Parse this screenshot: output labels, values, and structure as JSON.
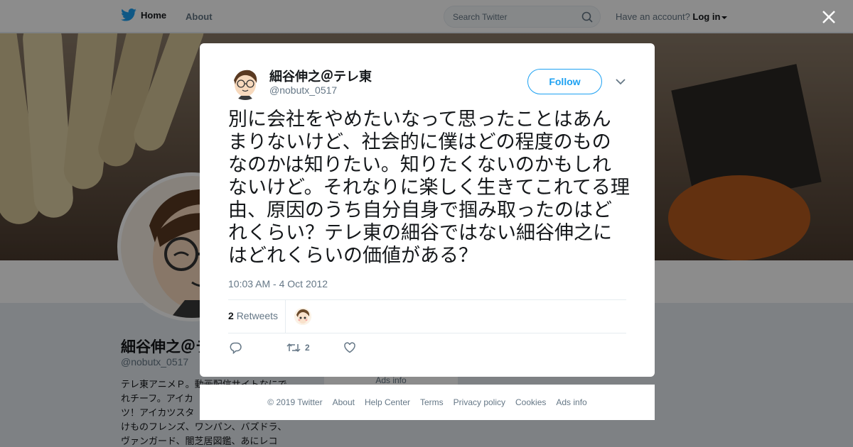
{
  "nav": {
    "home_label": "Home",
    "about_label": "About",
    "search_placeholder": "Search Twitter",
    "account_prompt": "Have an account?",
    "login_label": "Log in"
  },
  "background_profile": {
    "name": "細谷伸之＠テ",
    "handle": "@nobutx_0517",
    "bio_lines": [
      "テレ東アニメＰ。動画配信サイトなにで",
      "れチーフ。アイカ",
      "ツ！アイカツスタ",
      "けものフレンズ、ワンパン、バズドラ、",
      "ヴァンガード、闇芝居図鑑、あにレコ"
    ],
    "ads_info": "Ads info"
  },
  "tweet": {
    "display_name": "細谷伸之＠テレ東",
    "username": "@nobutx_0517",
    "follow_label": "Follow",
    "text": "別に会社をやめたいなって思ったことはあんまりないけど、社会的に僕はどの程度のものなのかは知りたい。知りたくないのかもしれないけど。それなりに楽しく生きてこれてる理由、原因のうち自分自身で掴み取ったのはどれくらい？テレ東の細谷ではない細谷伸之にはどれくらいの価値がある？",
    "timestamp": "10:03 AM - 4 Oct 2012",
    "retweet_count": "2",
    "retweets_label": "Retweets",
    "action_retweet_count": "2"
  },
  "footer": {
    "links": [
      "© 2019 Twitter",
      "About",
      "Help Center",
      "Terms",
      "Privacy policy",
      "Cookies",
      "Ads info"
    ]
  },
  "colors": {
    "accent": "#1da1f2",
    "secondary_text": "#657786",
    "overlay": "rgba(0,0,0,0.45)"
  },
  "icons": [
    "twitter-bird-icon",
    "search-icon",
    "close-icon",
    "chevron-down-icon",
    "reply-icon",
    "retweet-icon",
    "like-icon"
  ]
}
